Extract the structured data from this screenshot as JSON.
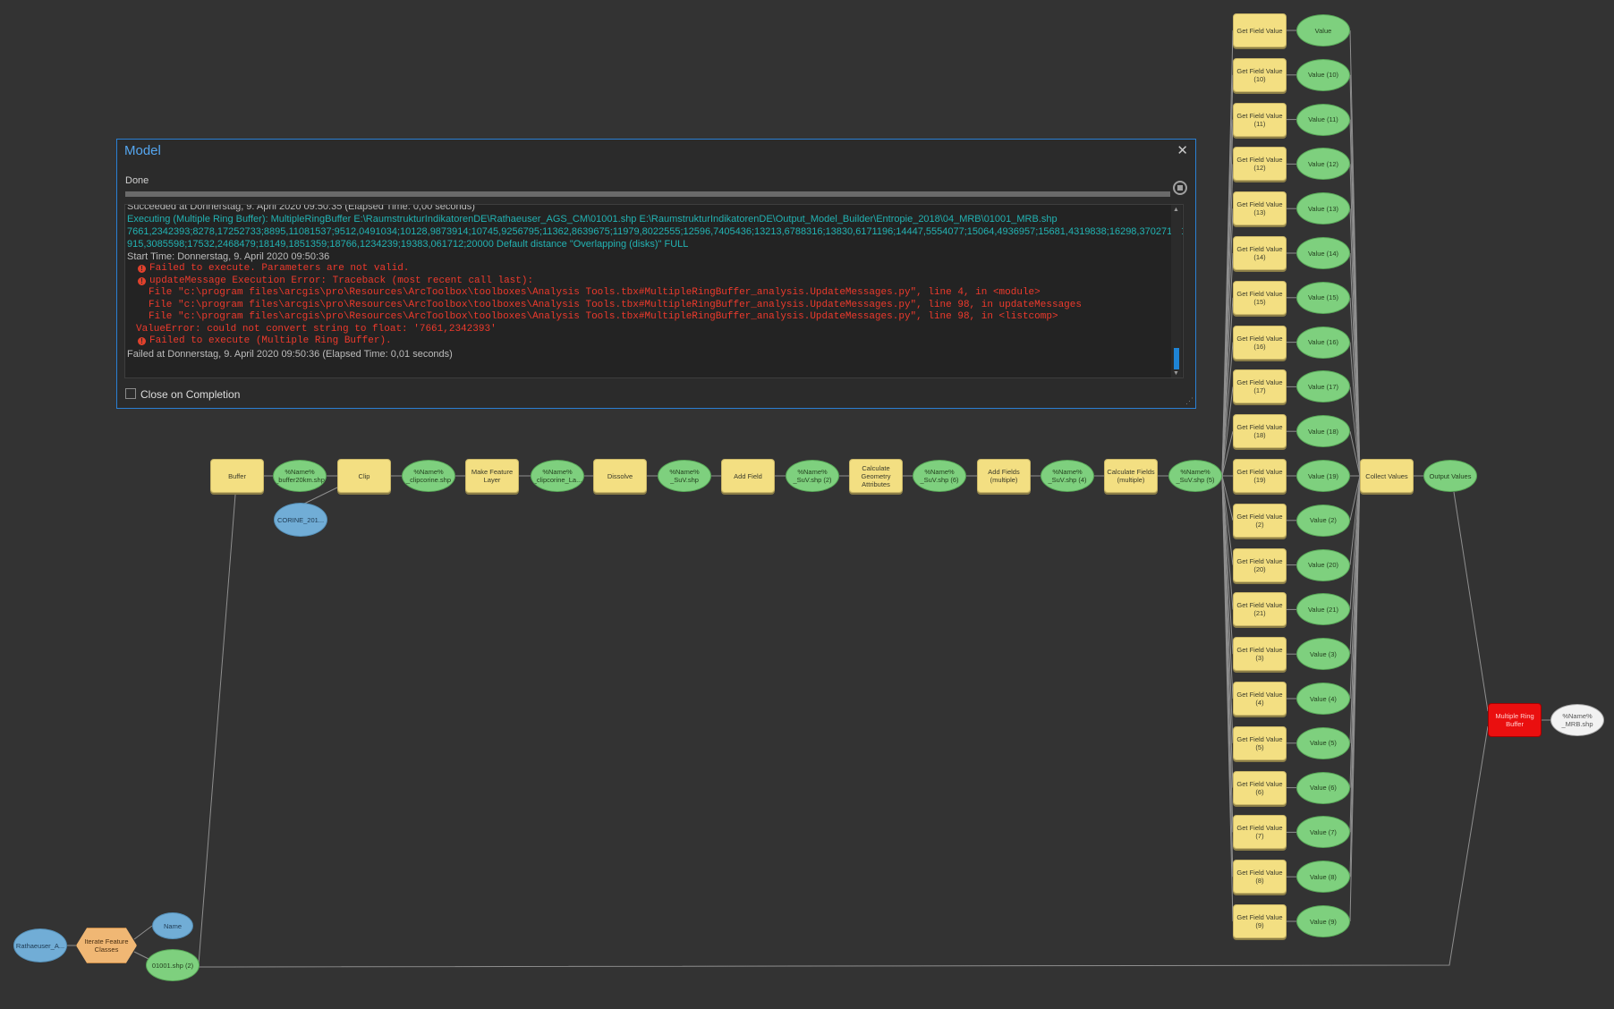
{
  "dialog": {
    "title": "Model",
    "status": "Done",
    "log": [
      {
        "kind": "info",
        "text": "Succeeded at Donnerstag, 9. April 2020 09:50:35 (Elapsed Time: 0,00 seconds)"
      },
      {
        "kind": "cyan",
        "text": "Executing (Multiple Ring Buffer): MultipleRingBuffer E:\\RaumstrukturIndikatorenDE\\Rathaeuser_AGS_CM\\01001.shp E:\\RaumstrukturIndikatorenDE\\Output_Model_Builder\\Entropie_2018\\04_MRB\\01001_MRB.shp"
      },
      {
        "kind": "cyan",
        "text": "7661,2342393;8278,17252733;8895,11081537;9512,0491034;10128,9873914;10745,9256795;11362,8639675;11979,8022555;12596,7405436;13213,6788316;13830,6171196;14447,5554077;15064,4936957;15681,4319838;16298,3702718;16"
      },
      {
        "kind": "cyan",
        "text": "915,3085598;17532,2468479;18149,1851359;18766,1234239;19383,061712;20000 Default distance \"Overlapping (disks)\" FULL"
      },
      {
        "kind": "info",
        "text": "Start Time: Donnerstag, 9. April 2020 09:50:36"
      },
      {
        "kind": "error-icon",
        "text": "Failed to execute. Parameters are not valid."
      },
      {
        "kind": "error-icon",
        "text": "updateMessage Execution Error: Traceback (most recent call last):"
      },
      {
        "kind": "error-indent",
        "text": "File \"c:\\program files\\arcgis\\pro\\Resources\\ArcToolbox\\toolboxes\\Analysis Tools.tbx#MultipleRingBuffer_analysis.UpdateMessages.py\", line 4, in <module>"
      },
      {
        "kind": "error-indent",
        "text": "File \"c:\\program files\\arcgis\\pro\\Resources\\ArcToolbox\\toolboxes\\Analysis Tools.tbx#MultipleRingBuffer_analysis.UpdateMessages.py\", line 98, in updateMessages"
      },
      {
        "kind": "error-indent",
        "text": "File \"c:\\program files\\arcgis\\pro\\Resources\\ArcToolbox\\toolboxes\\Analysis Tools.tbx#MultipleRingBuffer_analysis.UpdateMessages.py\", line 98, in <listcomp>"
      },
      {
        "kind": "error",
        "text": "ValueError: could not convert string to float: '7661,2342393'"
      },
      {
        "kind": "error-icon",
        "text": "Failed to execute (Multiple Ring Buffer)."
      },
      {
        "kind": "info",
        "text": "Failed at Donnerstag, 9. April 2020 09:50:36 (Elapsed Time: 0,01 seconds)"
      }
    ],
    "close_on_completion_label": "Close on Completion",
    "close_on_completion_checked": false
  },
  "chain": [
    {
      "type": "tool",
      "label": "Buffer"
    },
    {
      "type": "data",
      "label": "%Name% _buffer20km.shp"
    },
    {
      "type": "tool",
      "label": "Clip"
    },
    {
      "type": "data",
      "label": "%Name% _clipcorine.shp"
    },
    {
      "type": "tool",
      "label": "Make Feature Layer"
    },
    {
      "type": "data",
      "label": "%Name% _clipcorine_La..."
    },
    {
      "type": "tool",
      "label": "Dissolve"
    },
    {
      "type": "data",
      "label": "%Name% _SuV.shp"
    },
    {
      "type": "tool",
      "label": "Add Field"
    },
    {
      "type": "data",
      "label": "%Name% _SuV.shp (2)"
    },
    {
      "type": "tool",
      "label": "Calculate Geometry Attributes"
    },
    {
      "type": "data",
      "label": "%Name% _SuV.shp (6)"
    },
    {
      "type": "tool",
      "label": "Add Fields (multiple)"
    },
    {
      "type": "data",
      "label": "%Name% _SuV.shp (4)"
    },
    {
      "type": "tool",
      "label": "Calculate Fields (multiple)"
    },
    {
      "type": "data",
      "label": "%Name% _SuV.shp (5)"
    }
  ],
  "corine_label": "CORINE_201...",
  "field_values": [
    {
      "tool": "Get Field Value",
      "value": "Value"
    },
    {
      "tool": "Get Field Value (10)",
      "value": "Value (10)"
    },
    {
      "tool": "Get Field Value (11)",
      "value": "Value (11)"
    },
    {
      "tool": "Get Field Value (12)",
      "value": "Value (12)"
    },
    {
      "tool": "Get Field Value (13)",
      "value": "Value (13)"
    },
    {
      "tool": "Get Field Value (14)",
      "value": "Value (14)"
    },
    {
      "tool": "Get Field Value (15)",
      "value": "Value (15)"
    },
    {
      "tool": "Get Field Value (16)",
      "value": "Value (16)"
    },
    {
      "tool": "Get Field Value (17)",
      "value": "Value (17)"
    },
    {
      "tool": "Get Field Value (18)",
      "value": "Value (18)"
    },
    {
      "tool": "Get Field Value (19)",
      "value": "Value (19)"
    },
    {
      "tool": "Get Field Value (2)",
      "value": "Value (2)"
    },
    {
      "tool": "Get Field Value (20)",
      "value": "Value (20)"
    },
    {
      "tool": "Get Field Value (21)",
      "value": "Value (21)"
    },
    {
      "tool": "Get Field Value (3)",
      "value": "Value (3)"
    },
    {
      "tool": "Get Field Value (4)",
      "value": "Value (4)"
    },
    {
      "tool": "Get Field Value (5)",
      "value": "Value (5)"
    },
    {
      "tool": "Get Field Value (6)",
      "value": "Value (6)"
    },
    {
      "tool": "Get Field Value (7)",
      "value": "Value (7)"
    },
    {
      "tool": "Get Field Value (8)",
      "value": "Value (8)"
    },
    {
      "tool": "Get Field Value (9)",
      "value": "Value (9)"
    }
  ],
  "collect_label": "Collect Values",
  "output_values_label": "Output Values",
  "mrb_label": "Multiple Ring Buffer",
  "mrb_output_label": "%Name% _MRB.shp",
  "iterator": {
    "input_label": "Rathaeuser_A...",
    "iterate_label": "Iterate Feature Classes",
    "name_label": "Name",
    "shp_label": "01001.shp (2)"
  }
}
